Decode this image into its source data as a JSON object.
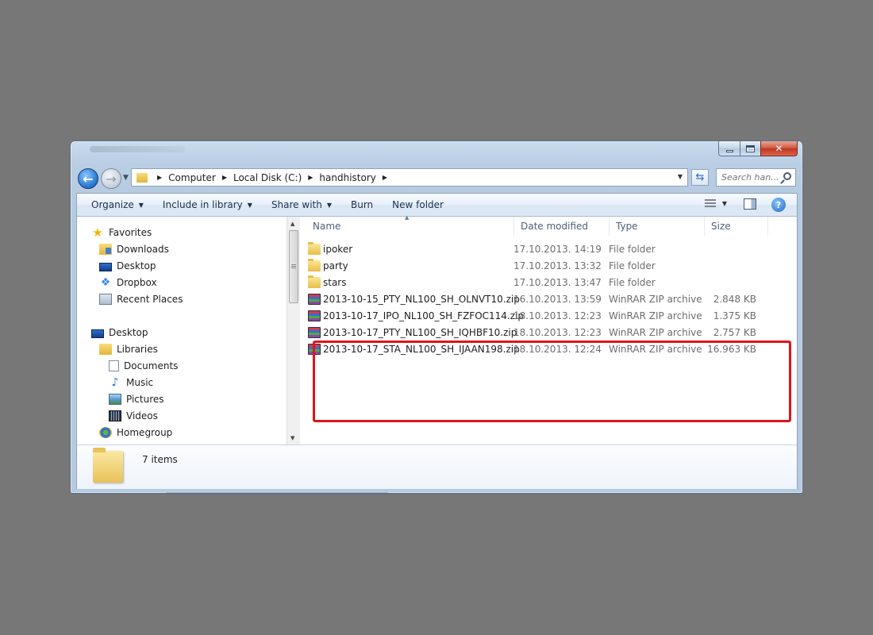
{
  "window": {
    "caption": {
      "minimize": "",
      "maximize": "",
      "close": "✕"
    }
  },
  "nav": {
    "back": "←",
    "forward": "→"
  },
  "address": {
    "crumbs": [
      "Computer",
      "Local Disk (C:)",
      "handhistory"
    ]
  },
  "search": {
    "placeholder": "Search han..."
  },
  "commandbar": {
    "organize": "Organize",
    "include": "Include in library",
    "share": "Share with",
    "burn": "Burn",
    "new_folder": "New folder",
    "help": "?"
  },
  "navpane": {
    "favorites": "Favorites",
    "downloads": "Downloads",
    "desktop": "Desktop",
    "dropbox": "Dropbox",
    "recent": "Recent Places",
    "desktop_root": "Desktop",
    "libraries": "Libraries",
    "documents": "Documents",
    "music": "Music",
    "pictures": "Pictures",
    "videos": "Videos",
    "homegroup": "Homegroup"
  },
  "columns": {
    "name": "Name",
    "date": "Date modified",
    "type": "Type",
    "size": "Size"
  },
  "files": [
    {
      "name": "ipoker",
      "date": "17.10.2013. 14:19",
      "type": "File folder",
      "size": "",
      "icon": "folder-icon"
    },
    {
      "name": "party",
      "date": "17.10.2013. 13:32",
      "type": "File folder",
      "size": "",
      "icon": "folder-icon"
    },
    {
      "name": "stars",
      "date": "17.10.2013. 13:47",
      "type": "File folder",
      "size": "",
      "icon": "folder-icon"
    },
    {
      "name": "2013-10-15_PTY_NL100_SH_OLNVT10.zip",
      "date": "16.10.2013. 13:59",
      "type": "WinRAR ZIP archive",
      "size": "2.848 KB",
      "icon": "winrar-zip-icon"
    },
    {
      "name": "2013-10-17_IPO_NL100_SH_FZFOC114.zip",
      "date": "18.10.2013. 12:23",
      "type": "WinRAR ZIP archive",
      "size": "1.375 KB",
      "icon": "winrar-zip-icon"
    },
    {
      "name": "2013-10-17_PTY_NL100_SH_IQHBF10.zip",
      "date": "18.10.2013. 12:23",
      "type": "WinRAR ZIP archive",
      "size": "2.757 KB",
      "icon": "winrar-zip-icon"
    },
    {
      "name": "2013-10-17_STA_NL100_SH_IJAAN198.zip",
      "date": "18.10.2013. 12:24",
      "type": "WinRAR ZIP archive",
      "size": "16.963 KB",
      "icon": "winrar-zip-icon"
    }
  ],
  "status": {
    "item_count": "7 items"
  },
  "colors": {
    "highlight": "#e0141b",
    "accent": "#2f7fd6"
  }
}
